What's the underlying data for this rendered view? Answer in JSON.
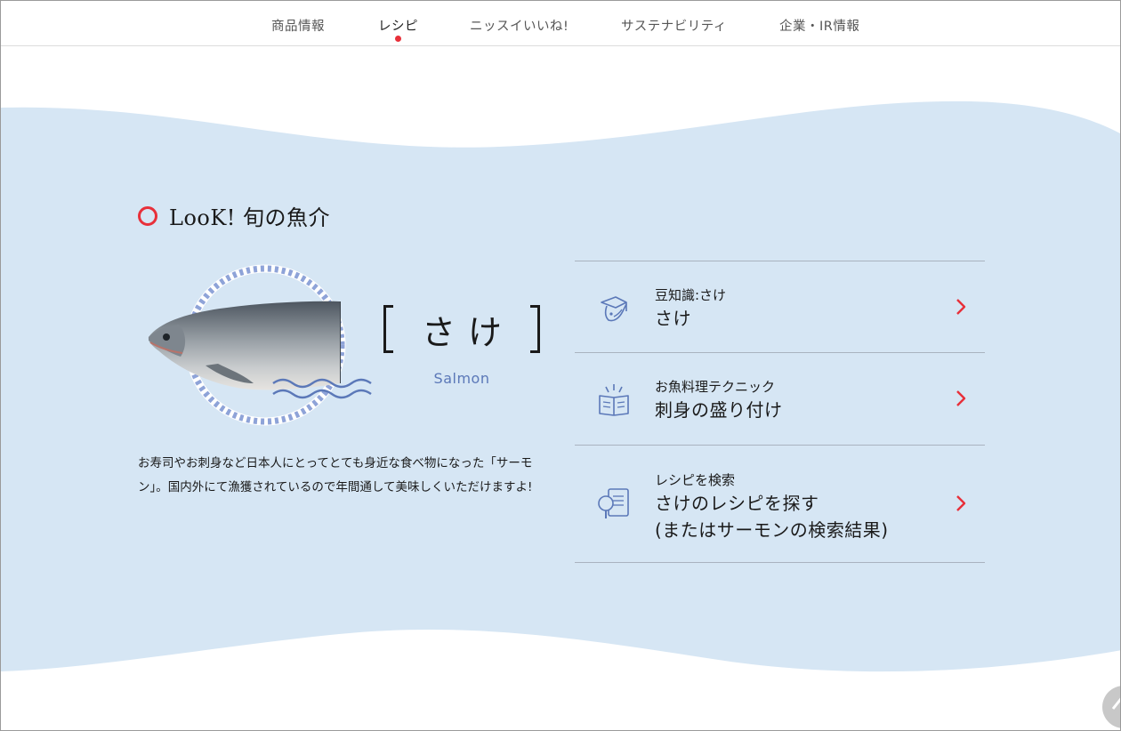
{
  "nav": {
    "items": [
      {
        "label": "商品情報"
      },
      {
        "label": "レシピ"
      },
      {
        "label": "ニッスイいいね!"
      },
      {
        "label": "サステナビリティ"
      },
      {
        "label": "企業・IR情報"
      }
    ],
    "active_index": 1
  },
  "section": {
    "title": "LooK! 旬の魚介"
  },
  "fish": {
    "name_jp": "さけ",
    "name_en": "Salmon",
    "description": "お寿司やお刺身など日本人にとってとても身近な食べ物になった「サーモン」。国内外にて漁獲されているので年間通して美味しくいただけますよ!"
  },
  "links": [
    {
      "small": "豆知識:さけ",
      "big": "さけ",
      "icon": "fish-knowledge-icon"
    },
    {
      "small": "お魚料理テクニック",
      "big": "刺身の盛り付け",
      "icon": "cooking-book-icon"
    },
    {
      "small": "レシピを検索",
      "big": "さけのレシピを探す",
      "big2": "(またはサーモンの検索結果)",
      "icon": "recipe-search-icon"
    }
  ],
  "colors": {
    "accent": "#e8303a",
    "wave": "#d6e6f4",
    "icon_blue": "#5b78b8"
  }
}
